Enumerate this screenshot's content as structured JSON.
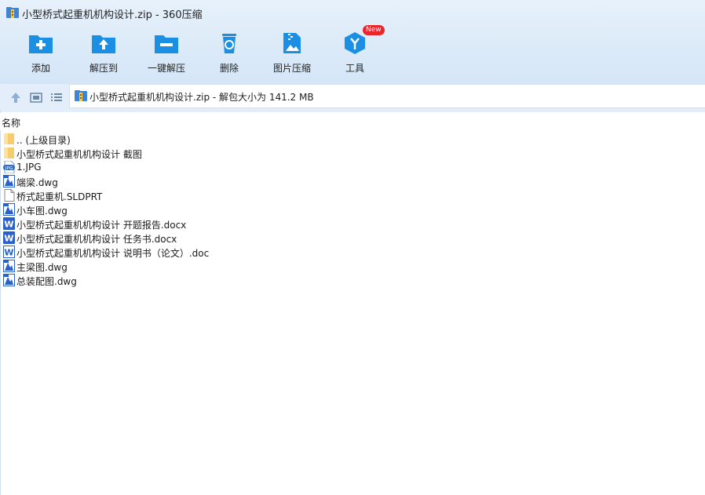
{
  "window": {
    "title": "小型桥式起重机机构设计.zip - 360压缩"
  },
  "toolbar": {
    "items": [
      {
        "label": "添加",
        "icon": "add-folder-icon"
      },
      {
        "label": "解压到",
        "icon": "extract-to-icon"
      },
      {
        "label": "一键解压",
        "icon": "one-click-extract-icon"
      },
      {
        "label": "删除",
        "icon": "delete-icon"
      },
      {
        "label": "图片压缩",
        "icon": "image-compress-icon"
      },
      {
        "label": "工具",
        "icon": "tools-icon"
      }
    ],
    "badge": "New"
  },
  "address": {
    "text": "小型桥式起重机机构设计.zip - 解包大小为 141.2 MB"
  },
  "columns": {
    "name": "名称"
  },
  "files": [
    {
      "name": ".. (上级目录)",
      "type": "folder"
    },
    {
      "name": "小型桥式起重机机构设计 截图",
      "type": "folder"
    },
    {
      "name": "1.JPG",
      "type": "jpg"
    },
    {
      "name": "端梁.dwg",
      "type": "dwg"
    },
    {
      "name": "桥式起重机.SLDPRT",
      "type": "file"
    },
    {
      "name": "小车图.dwg",
      "type": "dwg"
    },
    {
      "name": "小型桥式起重机机构设计 开题报告.docx",
      "type": "docx"
    },
    {
      "name": "小型桥式起重机机构设计 任务书.docx",
      "type": "docx"
    },
    {
      "name": "小型桥式起重机机构设计 说明书（论文）.doc",
      "type": "doc"
    },
    {
      "name": "主梁图.dwg",
      "type": "dwg"
    },
    {
      "name": "总装配图.dwg",
      "type": "dwg"
    }
  ],
  "colors": {
    "accent": "#1a8fe3",
    "badge": "#e8262c",
    "folder": "#f5cd6a",
    "word": "#2b5fc9"
  }
}
